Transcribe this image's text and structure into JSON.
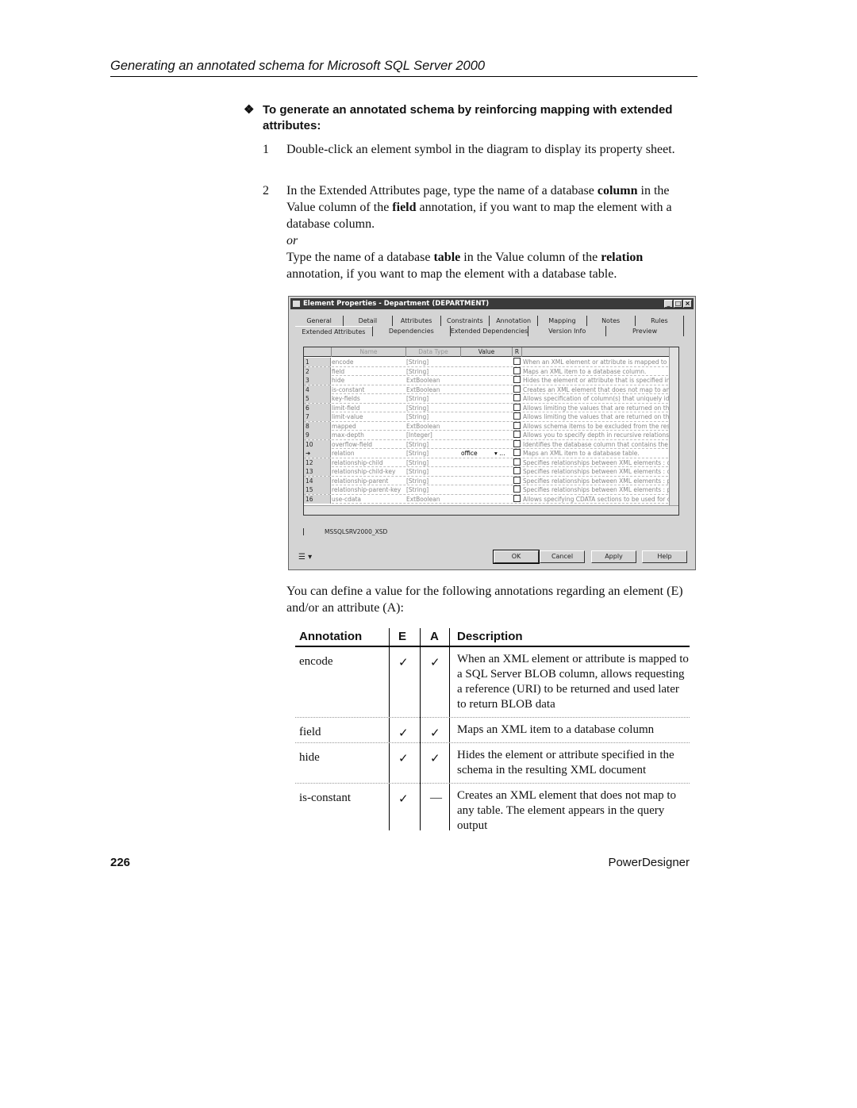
{
  "header": "Generating an annotated schema for Microsoft SQL Server 2000",
  "procedure": {
    "bullet": "❖",
    "title": "To generate an annotated schema by reinforcing mapping with extended attributes:"
  },
  "steps": [
    {
      "n": "1",
      "text": "Double-click an element symbol in the diagram to display its property sheet."
    },
    {
      "n": "2",
      "pre": "In the Extended Attributes page, type the name of a database ",
      "b1": "column",
      "mid": " in the Value column of the ",
      "b2": "field",
      "post": " annotation, if you want to map the element with a database column.",
      "or": "or",
      "alt_pre": "Type the name of a database ",
      "alt_b1": "table",
      "alt_mid": " in the Value column of the ",
      "alt_b2": "relation",
      "alt_post": " annotation, if you want to map the element with a database table."
    }
  ],
  "dialog": {
    "title": "Element Properties - Department (DEPARTMENT)",
    "tabs_row1": [
      "General",
      "Detail",
      "Attributes",
      "Constraints",
      "Annotation",
      "Mapping",
      "Notes",
      "Rules"
    ],
    "tabs_row2": [
      "Extended Attributes",
      "Dependencies",
      "Extended Dependencies",
      "Version Info",
      "Preview"
    ],
    "active_tab": "Extended Attributes",
    "columns": [
      "",
      "Name",
      "Data Type",
      "Value",
      "R",
      ""
    ],
    "rows": [
      [
        "1",
        "encode",
        "[String]",
        "",
        "When an XML element or attribute is mapped to a"
      ],
      [
        "2",
        "field",
        "[String]",
        "",
        "Maps an XML item to a database column."
      ],
      [
        "3",
        "hide",
        "ExtBoolean",
        "",
        "Hides the element or attribute that is specified in th"
      ],
      [
        "4",
        "is-constant",
        "ExtBoolean",
        "",
        "Creates an XML element that does not map to any"
      ],
      [
        "5",
        "key-fields",
        "[String]",
        "",
        "Allows specification of column(s) that uniquely iden"
      ],
      [
        "6",
        "limit-field",
        "[String]",
        "",
        "Allows limiting the values that are returned on the b"
      ],
      [
        "7",
        "limit-value",
        "[String]",
        "",
        "Allows limiting the values that are returned on the b"
      ],
      [
        "8",
        "mapped",
        "ExtBoolean",
        "",
        "Allows schema items to be excluded from the result"
      ],
      [
        "9",
        "max-depth",
        "[Integer]",
        "",
        "Allows you to specify depth in recursive relationship"
      ],
      [
        "10",
        "overflow-field",
        "[String]",
        "",
        "Identifies the database column that contains the ov"
      ],
      [
        "➜",
        "relation",
        "[String]",
        "office",
        "Maps an XML item to a database table."
      ],
      [
        "12",
        "relationship-child",
        "[String]",
        "",
        "Specifies relationships between XML elements : ch"
      ],
      [
        "13",
        "relationship-child-key",
        "[String]",
        "",
        "Specifies relationships between XML elements : ch"
      ],
      [
        "14",
        "relationship-parent",
        "[String]",
        "",
        "Specifies relationships between XML elements : pa"
      ],
      [
        "15",
        "relationship-parent-key",
        "[String]",
        "",
        "Specifies relationships between XML elements : pa"
      ],
      [
        "16",
        "use-cdata",
        "ExtBoolean",
        "",
        "Allows specifying CDATA sections to be used for c"
      ]
    ],
    "sheet_tab": "MSSQLSRV2000_XSD",
    "buttons": [
      "OK",
      "Cancel",
      "Apply",
      "Help"
    ]
  },
  "intro": "You can define a value for the following annotations regarding an element (E) and/or an attribute (A):",
  "table": {
    "headers": [
      "Annotation",
      "E",
      "A",
      "Description"
    ],
    "rows": [
      [
        "encode",
        "✓",
        "✓",
        "When an XML element or attribute is mapped to a SQL Server BLOB column, allows requesting a reference (URI) to be returned and used later to return BLOB data"
      ],
      [
        "field",
        "✓",
        "✓",
        "Maps an XML item to a database column"
      ],
      [
        "hide",
        "✓",
        "✓",
        "Hides the element or attribute specified in the schema in the resulting XML document"
      ],
      [
        "is-constant",
        "✓",
        "—",
        "Creates an XML element that does not map to any table. The element appears in the query output"
      ]
    ]
  },
  "footer": {
    "page": "226",
    "product": "PowerDesigner"
  }
}
